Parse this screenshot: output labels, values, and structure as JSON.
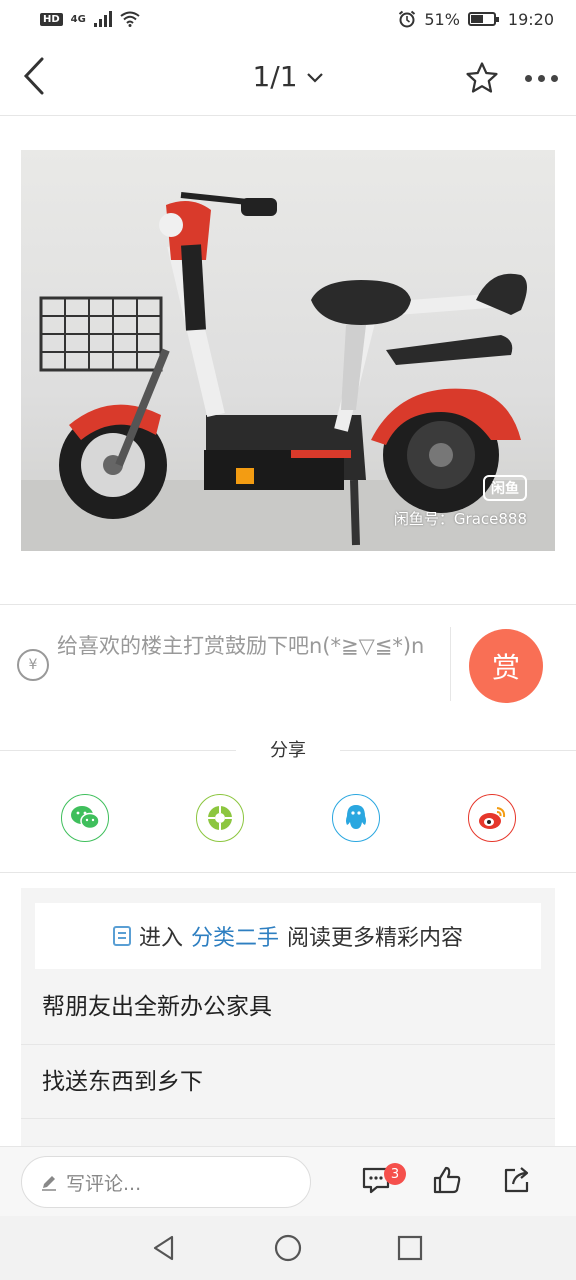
{
  "status_bar": {
    "left_badge": "HD",
    "network": "4G",
    "battery": "51%",
    "time": "19:20"
  },
  "nav": {
    "page_indicator": "1/1"
  },
  "photo": {
    "watermark_logo": "闲鱼",
    "watermark_text": "闲鱼号：Grace888"
  },
  "reward": {
    "currency_symbol": "¥",
    "prompt": "给喜欢的楼主打赏鼓励下吧n(*≧▽≦*)n",
    "button_label": "赏"
  },
  "share": {
    "label": "分享",
    "targets": [
      "wechat",
      "moments",
      "qq",
      "weibo"
    ]
  },
  "more": {
    "banner_prefix": "进入",
    "banner_link": "分类二手",
    "banner_suffix": "阅读更多精彩内容",
    "items": [
      "帮朋友出全新办公家具",
      "找送东西到乡下"
    ]
  },
  "bottom_bar": {
    "comment_placeholder": "写评论...",
    "comment_count": "3"
  },
  "colors": {
    "accent_reward": "#f96f55",
    "link_blue": "#2e7fc1",
    "wechat_green": "#3fbf5c",
    "qq_blue": "#2aa7e0",
    "weibo_red": "#e6372b",
    "badge_red": "#f5504c"
  }
}
